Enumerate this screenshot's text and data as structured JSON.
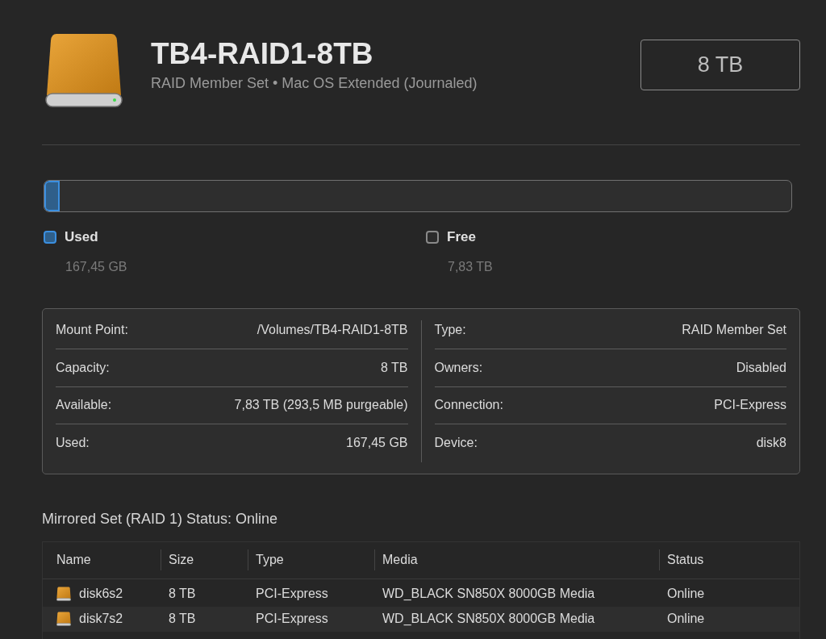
{
  "header": {
    "title": "TB4-RAID1-8TB",
    "subtitle": "RAID Member Set • Mac OS Extended (Journaled)",
    "capacity": "8 TB"
  },
  "usage": {
    "segments": [
      {
        "label": "Used",
        "value": "167,45 GB",
        "color": "#2f5f8a",
        "level": 0.02
      },
      {
        "label": "Free",
        "value": "7,83 TB",
        "color": "#2b2b2b"
      }
    ]
  },
  "info": {
    "left": [
      {
        "label": "Mount Point:",
        "value": "/Volumes/TB4-RAID1-8TB"
      },
      {
        "label": "Capacity:",
        "value": "8 TB"
      },
      {
        "label": "Available:",
        "value": "7,83 TB (293,5 MB purgeable)"
      },
      {
        "label": "Used:",
        "value": "167,45 GB"
      }
    ],
    "right": [
      {
        "label": "Type:",
        "value": "RAID Member Set"
      },
      {
        "label": "Owners:",
        "value": "Disabled"
      },
      {
        "label": "Connection:",
        "value": "PCI-Express"
      },
      {
        "label": "Device:",
        "value": "disk8"
      }
    ]
  },
  "raid": {
    "title": "Mirrored Set (RAID 1) Status: Online",
    "table": {
      "columns": [
        "Name",
        "Size",
        "Type",
        "Media",
        "Status"
      ],
      "rows": [
        {
          "cells": [
            "disk6s2",
            "8 TB",
            "PCI-Express",
            "WD_BLACK SN850X 8000GB Media",
            "Online"
          ]
        },
        {
          "cells": [
            "disk7s2",
            "8 TB",
            "PCI-Express",
            "WD_BLACK SN850X 8000GB Media",
            "Online"
          ]
        }
      ]
    }
  }
}
